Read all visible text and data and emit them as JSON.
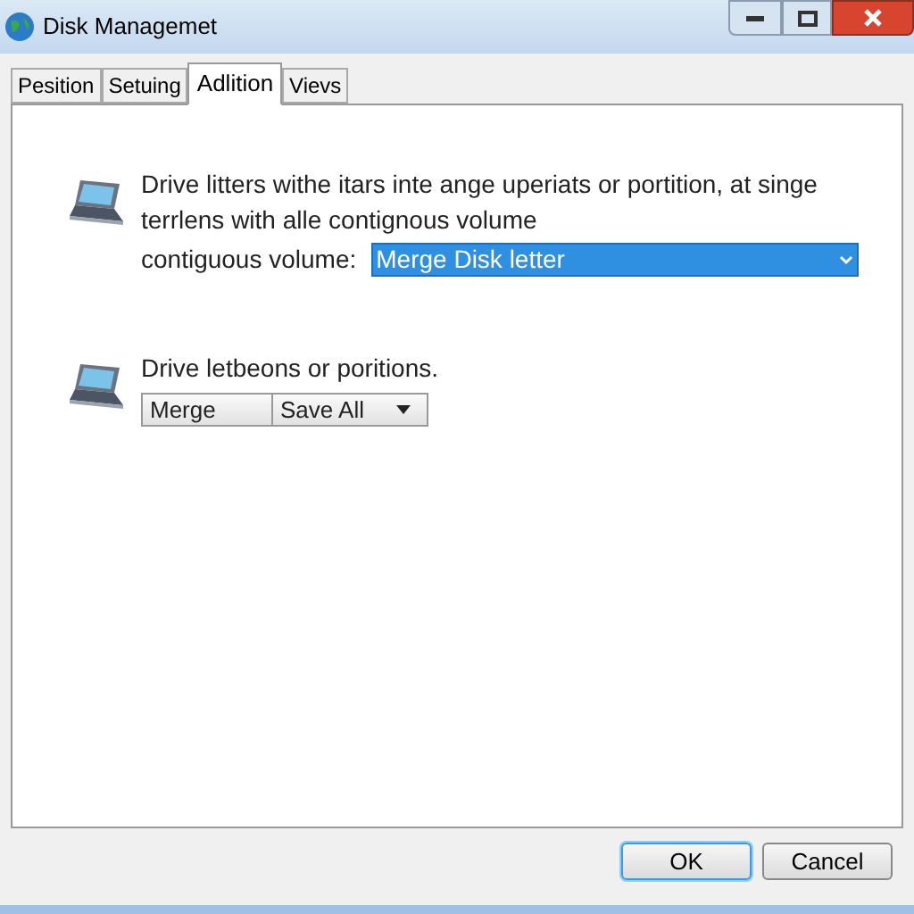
{
  "window": {
    "title": "Disk Managemet"
  },
  "tabs": [
    {
      "label": "Pesition",
      "selected": false
    },
    {
      "label": "Setuing",
      "selected": false
    },
    {
      "label": "Adlition",
      "selected": true
    },
    {
      "label": "Vievs",
      "selected": false
    }
  ],
  "sections": [
    {
      "kind": "dropdown",
      "text": "Drive litters withe itars inte ange uperiats or portition, at singe terrlens with alle contignous volume",
      "label": "contiguous volume:",
      "value": "Merge Disk letter"
    },
    {
      "kind": "buttons",
      "text": "Drive letbeons or poritions.",
      "buttons": [
        "Merge",
        "Save All"
      ]
    }
  ],
  "buttons": [
    {
      "label": "OK",
      "default": true
    },
    {
      "label": "Cancel",
      "default": false
    }
  ]
}
